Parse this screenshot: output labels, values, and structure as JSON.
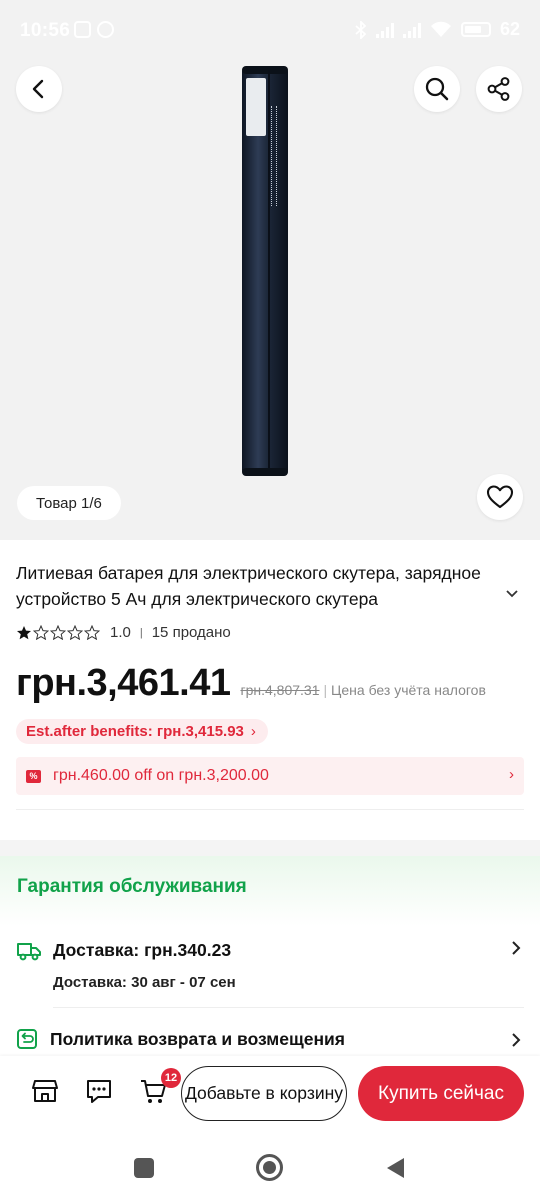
{
  "status_bar": {
    "time": "10:56",
    "battery_percent": "62"
  },
  "gallery": {
    "counter": "Товар 1/6"
  },
  "product": {
    "title": "Литиевая батарея для электрического скутера, зарядное устройство 5 Ач для электрического скутера",
    "rating": "1.0",
    "rating_stars_filled": 1,
    "rating_stars_total": 5,
    "sold": "15 продано",
    "price": "грн.3,461.41",
    "old_price": "грн.4,807.31",
    "tax_note": "Цена без учёта налогов",
    "benefit": "Est.after benefits: грн.3,415.93",
    "coupon": "грн.460.00 off on грн.3,200.00"
  },
  "guarantee": {
    "title": "Гарантия обслуживания",
    "delivery_label": "Доставка:  грн.340.23",
    "delivery_date": "Доставка: 30 авг - 07 сен",
    "refund_label": "Политика возврата и возмещения"
  },
  "actions": {
    "cart_count": "12",
    "add_to_cart": "Добавьте в корзину",
    "buy_now": "Купить сейчас"
  },
  "colors": {
    "accent": "#e0283b",
    "guarantee_green": "#11a24a",
    "gallery_bg": "#f2f2f2"
  },
  "icons": [
    "back-icon",
    "search-icon",
    "share-icon",
    "heart-icon",
    "truck-icon",
    "return-icon",
    "store-icon",
    "chat-icon",
    "cart-icon",
    "chevron-right-icon",
    "chevron-down-icon",
    "star-icon",
    "coupon-icon",
    "nav-square-icon",
    "nav-home-icon",
    "nav-back-icon"
  ]
}
